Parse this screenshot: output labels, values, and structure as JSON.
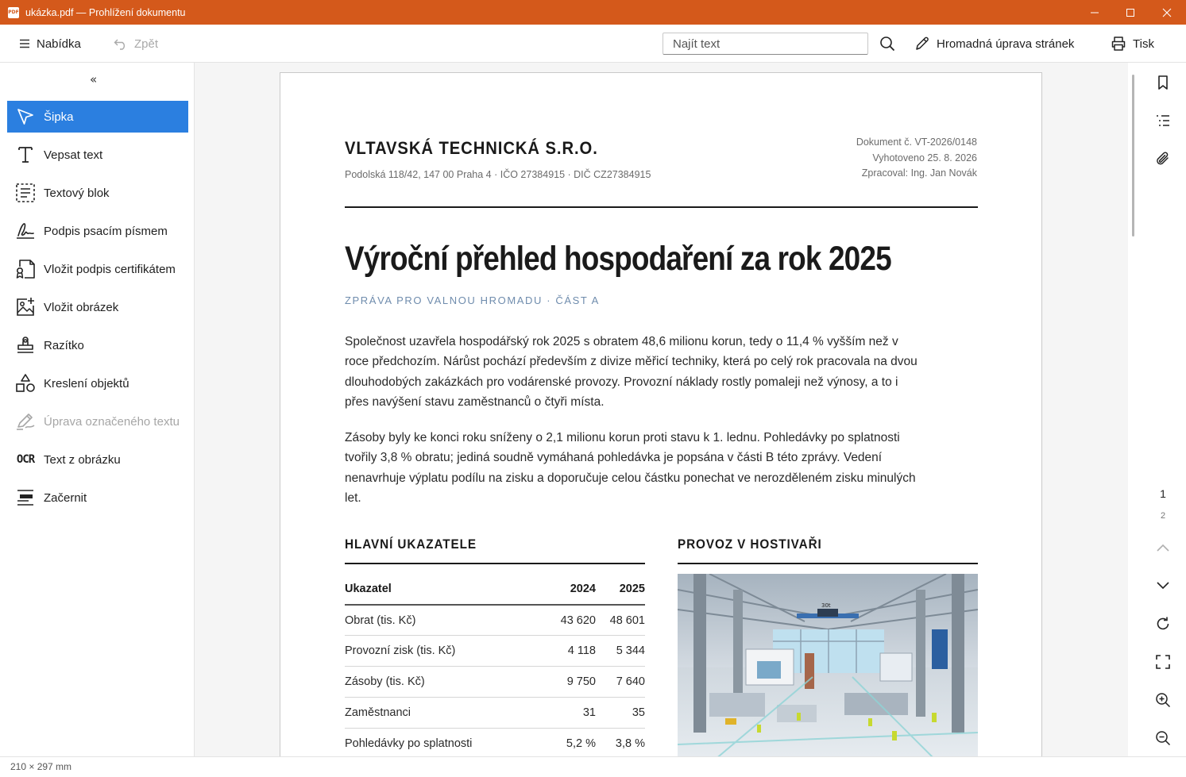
{
  "window": {
    "title": "ukázka.pdf — Prohlížení dokumentu",
    "app_icon_text": "PDF",
    "accent": "#d4591b"
  },
  "toolbar": {
    "menu_label": "Nabídka",
    "back_label": "Zpět",
    "search_placeholder": "Najít text",
    "batch_edit_label": "Hromadná úprava stránek",
    "print_label": "Tisk"
  },
  "left_panel": {
    "collapse_glyph": "«",
    "tools": [
      {
        "label": "Šipka",
        "icon": "arrow-pointer-icon",
        "active": true
      },
      {
        "label": "Vepsat text",
        "icon": "text-cursor-icon"
      },
      {
        "label": "Textový blok",
        "icon": "text-block-icon"
      },
      {
        "label": "Podpis psacím písmem",
        "icon": "signature-icon"
      },
      {
        "label": "Vložit podpis certifikátem",
        "icon": "certificate-signature-icon"
      },
      {
        "label": "Vložit obrázek",
        "icon": "add-image-icon"
      },
      {
        "label": "Razítko",
        "icon": "stamp-icon"
      },
      {
        "label": "Kreslení objektů",
        "icon": "shapes-icon"
      },
      {
        "label": "Úprava označeného textu",
        "icon": "highlight-edit-icon",
        "disabled": true
      },
      {
        "label": "Text z obrázku",
        "icon": "ocr-icon"
      },
      {
        "label": "Začernit",
        "icon": "redact-icon"
      }
    ],
    "ocr_glyph": "OCR",
    "active_color": "#2b7fe0"
  },
  "document": {
    "company": "VLTAVSKÁ TECHNICKÁ S.R.O.",
    "address": "Podolská 118/42, 147 00 Praha 4 · IČO 27384915 · DIČ CZ27384915",
    "meta": [
      "Dokument č. VT-2026/0148",
      "Vyhotoveno 25. 8. 2026",
      "Zpracoval: Ing. Jan Novák"
    ],
    "title": "Výroční přehled hospodaření za rok 2025",
    "subtitle": "ZPRÁVA PRO VALNOU HROMADU · ČÁST A",
    "paragraph1": "Společnost uzavřela hospodářský rok 2025 s obratem 48,6 milionu korun, tedy o 11,4 % vyšším než v roce předchozím. Nárůst pochází především z divize měřicí techniky, která po celý rok pracovala na dvou dlouhodobých zakázkách pro vodárenské provozy. Provozní náklady rostly pomaleji než výnosy, a to i přes navýšení stavu zaměstnanců o čtyři místa.",
    "paragraph2": "Zásoby byly ke konci roku sníženy o 2,1 milionu korun proti stavu k 1. lednu. Pohledávky po splatnosti tvořily 3,8 % obratu; jediná soudně vymáhaná pohledávka je popsána v části B této zprávy. Vedení nenavrhuje výplatu podílu na zisku a doporučuje celou částku ponechat ve nerozděleném zisku minulých let.",
    "indicators": {
      "title": "HLAVNÍ UKAZATELE",
      "headers": [
        "Ukazatel",
        "2024",
        "2025"
      ],
      "rows": [
        [
          "Obrat (tis. Kč)",
          "43 620",
          "48 601"
        ],
        [
          "Provozní zisk (tis. Kč)",
          "4 118",
          "5 344"
        ],
        [
          "Zásoby (tis. Kč)",
          "9 750",
          "7 640"
        ],
        [
          "Zaměstnanci",
          "31",
          "35"
        ],
        [
          "Pohledávky po splatnosti",
          "5,2 %",
          "3,8 %"
        ]
      ]
    },
    "photo_section": {
      "title": "PROVOZ V HOSTIVAŘI",
      "photo_sign": "30t"
    }
  },
  "right_bar": {
    "icons": [
      "bookmark-icon",
      "outline-icon",
      "attachment-icon"
    ],
    "pages": [
      "1",
      "2"
    ]
  },
  "status": {
    "page_size": "210 × 297 mm"
  }
}
